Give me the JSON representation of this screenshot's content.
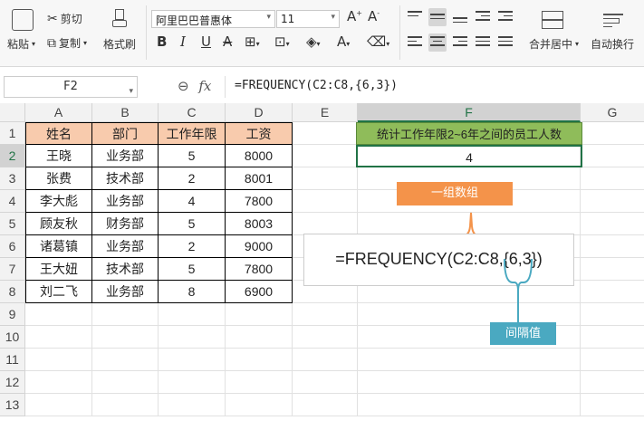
{
  "ribbon": {
    "paste": "粘贴",
    "cut": "剪切",
    "copy": "复制",
    "format_painter": "格式刷",
    "font_name": "阿里巴巴普惠体",
    "font_size": "11",
    "merge_center": "合并居中",
    "auto_wrap": "自动换行"
  },
  "formula_bar": {
    "name_box": "F2",
    "fx": "fx",
    "formula": "=FREQUENCY(C2:C8,{6,3})"
  },
  "columns": [
    "A",
    "B",
    "C",
    "D",
    "E",
    "F",
    "G"
  ],
  "rows": [
    "1",
    "2",
    "3",
    "4",
    "5",
    "6",
    "7",
    "8",
    "9",
    "10",
    "11",
    "12",
    "13"
  ],
  "table": {
    "headers": [
      "姓名",
      "部门",
      "工作年限",
      "工资"
    ],
    "data": [
      [
        "王晓",
        "业务部",
        "5",
        "8000"
      ],
      [
        "张费",
        "技术部",
        "2",
        "8001"
      ],
      [
        "李大彪",
        "业务部",
        "4",
        "7800"
      ],
      [
        "顾友秋",
        "财务部",
        "5",
        "8003"
      ],
      [
        "诸葛镇",
        "业务部",
        "2",
        "9000"
      ],
      [
        "王大妞",
        "技术部",
        "5",
        "7800"
      ],
      [
        "刘二飞",
        "业务部",
        "8",
        "6900"
      ]
    ]
  },
  "result": {
    "header": "统计工作年限2~6年之间的员工人数",
    "value": "4"
  },
  "annotations": {
    "formula": "=FREQUENCY(C2:C8,{6,3})",
    "array_label": "一组数组",
    "interval_label": "间隔值"
  },
  "colors": {
    "table_header": "#f8cbad",
    "result_header": "#8fbc5a",
    "array_callout": "#f4934a",
    "interval_callout": "#4aa9c1",
    "selection": "#217346"
  }
}
